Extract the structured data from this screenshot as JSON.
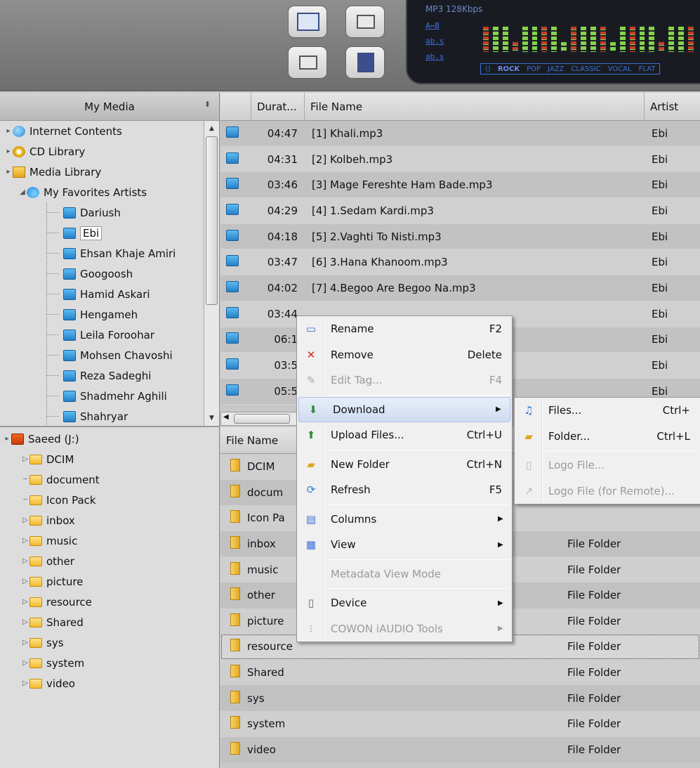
{
  "toolbar": {
    "eq_top": "MP3 128Kbps",
    "eq_rows": [
      "A↔B",
      "ab.s",
      "ab.s"
    ],
    "presets": [
      "ROCK",
      "POP",
      "JAZZ",
      "CLASSIC",
      "VOCAL",
      "FLAT"
    ],
    "active_preset": "ROCK"
  },
  "library": {
    "header": "My Media",
    "tree": [
      {
        "label": "Internet Contents",
        "icon": "globe-icon",
        "level": 0
      },
      {
        "label": "CD Library",
        "icon": "cd-icon",
        "level": 0
      },
      {
        "label": "Media Library",
        "icon": "library-icon",
        "level": 0
      },
      {
        "label": "My Favorites Artists",
        "icon": "favorites-icon",
        "level": 1
      },
      {
        "label": "Dariush",
        "icon": "music-note-icon",
        "level": 2
      },
      {
        "label": "Ebi",
        "icon": "music-note-icon",
        "level": 2,
        "selected": true
      },
      {
        "label": "Ehsan Khaje Amiri",
        "icon": "music-note-icon",
        "level": 2
      },
      {
        "label": "Googoosh",
        "icon": "music-note-icon",
        "level": 2
      },
      {
        "label": "Hamid Askari",
        "icon": "music-note-icon",
        "level": 2
      },
      {
        "label": "Hengameh",
        "icon": "music-note-icon",
        "level": 2
      },
      {
        "label": "Leila Foroohar",
        "icon": "music-note-icon",
        "level": 2
      },
      {
        "label": "Mohsen Chavoshi",
        "icon": "music-note-icon",
        "level": 2
      },
      {
        "label": "Reza Sadeghi",
        "icon": "music-note-icon",
        "level": 2
      },
      {
        "label": "Shadmehr Aghili",
        "icon": "music-note-icon",
        "level": 2
      },
      {
        "label": "Shahryar",
        "icon": "music-note-icon",
        "level": 2
      }
    ]
  },
  "device": {
    "drive": "Saeed (J:)",
    "folders": [
      {
        "label": "DCIM",
        "expander": true
      },
      {
        "label": "document",
        "expander": false
      },
      {
        "label": "Icon Pack",
        "expander": false
      },
      {
        "label": "inbox",
        "expander": true
      },
      {
        "label": "music",
        "expander": true
      },
      {
        "label": "other",
        "expander": true
      },
      {
        "label": "picture",
        "expander": true
      },
      {
        "label": "resource",
        "expander": true
      },
      {
        "label": "Shared",
        "expander": true
      },
      {
        "label": "sys",
        "expander": true
      },
      {
        "label": "system",
        "expander": true
      },
      {
        "label": "video",
        "expander": true
      }
    ]
  },
  "tracks": {
    "columns": {
      "duration": "Durat...",
      "file_name": "File Name",
      "artist": "Artist"
    },
    "rows": [
      {
        "duration": "04:47",
        "name": "[1] Khali.mp3",
        "artist": "Ebi"
      },
      {
        "duration": "04:31",
        "name": "[2] Kolbeh.mp3",
        "artist": "Ebi"
      },
      {
        "duration": "03:46",
        "name": "[3] Mage Fereshte Ham Bade.mp3",
        "artist": "Ebi"
      },
      {
        "duration": "04:29",
        "name": "[4] 1.Sedam Kardi.mp3",
        "artist": "Ebi"
      },
      {
        "duration": "04:18",
        "name": "[5] 2.Vaghti To Nisti.mp3",
        "artist": "Ebi"
      },
      {
        "duration": "03:47",
        "name": "[6] 3.Hana Khanoom.mp3",
        "artist": "Ebi"
      },
      {
        "duration": "04:02",
        "name": "[7] 4.Begoo Are Begoo Na.mp3",
        "artist": "Ebi"
      },
      {
        "duration": "03:44",
        "name": "",
        "artist": "Ebi"
      },
      {
        "duration": "06:1",
        "name": "",
        "artist": "Ebi"
      },
      {
        "duration": "03:5",
        "name": "",
        "artist": "Ebi"
      },
      {
        "duration": "05:5",
        "name": "mp3",
        "artist": "Ebi"
      }
    ]
  },
  "files": {
    "columns": {
      "file_name": "File Name"
    },
    "rows": [
      {
        "name": "DCIM",
        "type": ""
      },
      {
        "name": "docum",
        "type": ""
      },
      {
        "name": "Icon Pa",
        "type": ""
      },
      {
        "name": "inbox",
        "type": "File Folder"
      },
      {
        "name": "music",
        "type": "File Folder"
      },
      {
        "name": "other",
        "type": "File Folder"
      },
      {
        "name": "picture",
        "type": "File Folder"
      },
      {
        "name": "resource",
        "type": "File Folder",
        "focused": true
      },
      {
        "name": "Shared",
        "type": "File Folder"
      },
      {
        "name": "sys",
        "type": "File Folder"
      },
      {
        "name": "system",
        "type": "File Folder"
      },
      {
        "name": "video",
        "type": "File Folder"
      }
    ]
  },
  "context_menu": {
    "items": [
      {
        "label": "Rename",
        "shortcut": "F2",
        "icon": "rename-icon",
        "glyph": "▭",
        "color": "#3a6fd8"
      },
      {
        "label": "Remove",
        "shortcut": "Delete",
        "icon": "remove-icon",
        "glyph": "✕",
        "color": "#d9261c"
      },
      {
        "label": "Edit Tag...",
        "shortcut": "F4",
        "icon": "edit-tag-icon",
        "glyph": "✎",
        "color": "#aaaaaa",
        "disabled": true
      },
      {
        "label": "Download",
        "shortcut": "",
        "icon": "download-icon",
        "glyph": "⬇",
        "color": "#2f8a3a",
        "submenu": true,
        "highlighted": true
      },
      {
        "label": "Upload Files...",
        "shortcut": "Ctrl+U",
        "icon": "upload-icon",
        "glyph": "⬆",
        "color": "#2f8a3a"
      },
      {
        "label": "New Folder",
        "shortcut": "Ctrl+N",
        "icon": "new-folder-icon",
        "glyph": "▰",
        "color": "#e0a420"
      },
      {
        "label": "Refresh",
        "shortcut": "F5",
        "icon": "refresh-icon",
        "glyph": "⟳",
        "color": "#2e7fd0"
      },
      {
        "label": "Columns",
        "shortcut": "",
        "icon": "columns-icon",
        "glyph": "▤",
        "color": "#3a6fd8",
        "submenu": true
      },
      {
        "label": "View",
        "shortcut": "",
        "icon": "view-icon",
        "glyph": "▦",
        "color": "#3a6fd8",
        "submenu": true
      },
      {
        "label": "Metadata View Mode",
        "shortcut": "",
        "icon": "",
        "glyph": "",
        "color": "#888888",
        "disabled": true
      },
      {
        "label": "Device",
        "shortcut": "",
        "icon": "device-icon",
        "glyph": "▯",
        "color": "#666666",
        "submenu": true
      },
      {
        "label": "COWON iAUDIO Tools",
        "shortcut": "",
        "icon": "tools-icon",
        "glyph": "⁝",
        "color": "#aaaaaa",
        "submenu": true,
        "disabled": true
      }
    ],
    "separators_after": [
      2,
      4,
      6,
      8,
      9
    ]
  },
  "download_submenu": {
    "items": [
      {
        "label": "Files...",
        "shortcut": "Ctrl+",
        "icon": "music-file-icon",
        "glyph": "♫",
        "color": "#2e6fd0"
      },
      {
        "label": "Folder...",
        "shortcut": "Ctrl+L",
        "icon": "folder-icon",
        "glyph": "▰",
        "color": "#e0a420"
      },
      {
        "label": "Logo File...",
        "shortcut": "",
        "icon": "logo-file-icon",
        "glyph": "▯",
        "color": "#bbbbbb",
        "disabled": true
      },
      {
        "label": "Logo File (for Remote)...",
        "shortcut": "",
        "icon": "logo-remote-icon",
        "glyph": "↗",
        "color": "#bbbbbb",
        "disabled": true
      }
    ],
    "separators_after": [
      1
    ]
  }
}
